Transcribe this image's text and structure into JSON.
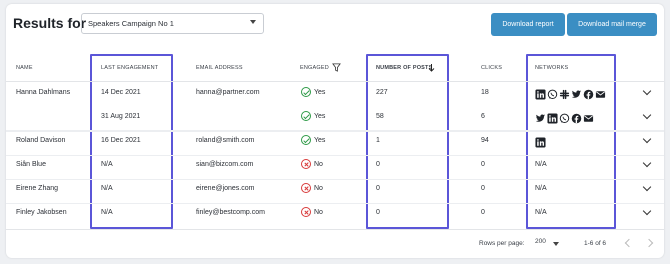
{
  "header": {
    "title": "Results for",
    "campaign_selected": "Speakers Campaign No 1",
    "download_report": "Download report",
    "download_mail_merge": "Download mail merge"
  },
  "columns": {
    "name": "NAME",
    "last_engagement": "LAST ENGAGEMENT",
    "email": "EMAIL ADDRESS",
    "engaged": "ENGAGED",
    "posts": "NUMBER OF POSTS",
    "clicks": "CLICKS",
    "networks": "NETWORKS"
  },
  "rows": [
    {
      "name": "Hanna Dahlmans",
      "last": "14 Dec 2021",
      "email": "hanna@partner.com",
      "engaged": "Yes",
      "posts": "227",
      "clicks": "18",
      "networks": [
        "linkedin-icon",
        "whatsapp-icon",
        "slack-icon",
        "twitter-icon",
        "facebook-icon",
        "mail-icon"
      ]
    },
    {
      "name": "",
      "last": "31 Aug 2021",
      "email": "",
      "engaged": "Yes",
      "posts": "58",
      "clicks": "6",
      "networks": [
        "twitter-icon",
        "linkedin-icon",
        "whatsapp-icon",
        "facebook-icon",
        "mail-icon"
      ]
    },
    {
      "name": "Roland Davison",
      "last": "16 Dec 2021",
      "email": "roland@smith.com",
      "engaged": "Yes",
      "posts": "1",
      "clicks": "94",
      "networks": [
        "linkedin-icon"
      ]
    },
    {
      "name": "Siân Blue",
      "last": "N/A",
      "email": "sian@bizcom.com",
      "engaged": "No",
      "posts": "0",
      "clicks": "0",
      "networks_text": "N/A"
    },
    {
      "name": "Eirene Zhang",
      "last": "N/A",
      "email": "eirene@jones.com",
      "engaged": "No",
      "posts": "0",
      "clicks": "0",
      "networks_text": "N/A"
    },
    {
      "name": "Finley Jakobsen",
      "last": "N/A",
      "email": "finley@bestcomp.com",
      "engaged": "No",
      "posts": "0",
      "clicks": "0",
      "networks_text": "N/A"
    }
  ],
  "footer": {
    "rows_per_page_label": "Rows per page:",
    "rows_per_page_value": "200",
    "range": "1-6 of 6"
  },
  "colors": {
    "accent": "#3b8ec3",
    "highlight": "#5b56d8",
    "yes": "#2e9a47",
    "no": "#d83a3a"
  }
}
